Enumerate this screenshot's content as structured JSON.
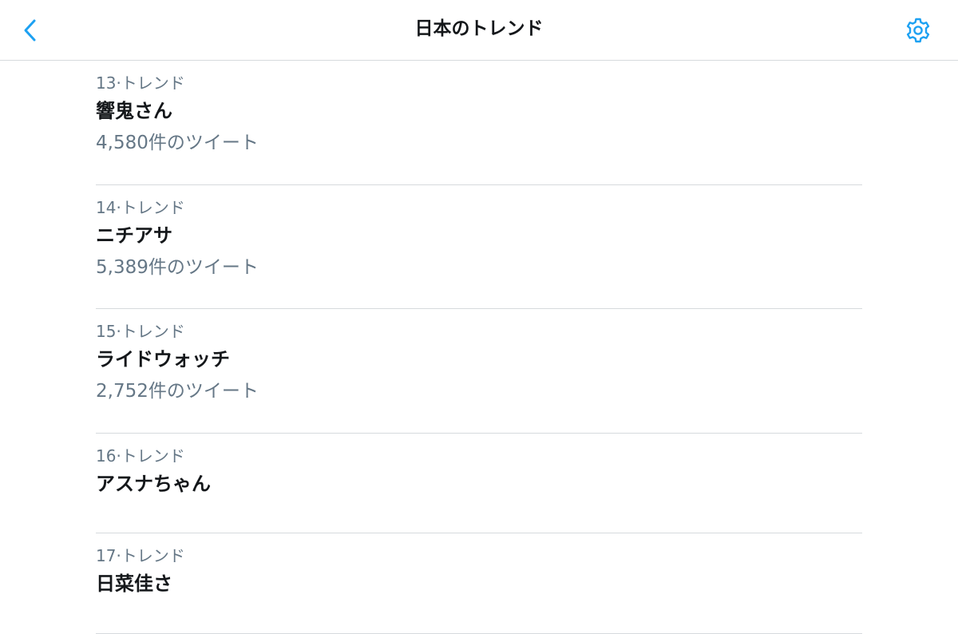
{
  "header": {
    "title": "日本のトレンド",
    "back_icon": "chevron-left-icon",
    "settings_icon": "gear-icon",
    "accent_color": "#1da1f2"
  },
  "trends": [
    {
      "meta": "13·トレンド",
      "name": "響鬼さん",
      "count": "4,580件のツイート"
    },
    {
      "meta": "14·トレンド",
      "name": "ニチアサ",
      "count": "5,389件のツイート"
    },
    {
      "meta": "15·トレンド",
      "name": "ライドウォッチ",
      "count": "2,752件のツイート"
    },
    {
      "meta": "16·トレンド",
      "name": "アスナちゃん"
    },
    {
      "meta": "17·トレンド",
      "name": "日菜佳さ"
    }
  ]
}
